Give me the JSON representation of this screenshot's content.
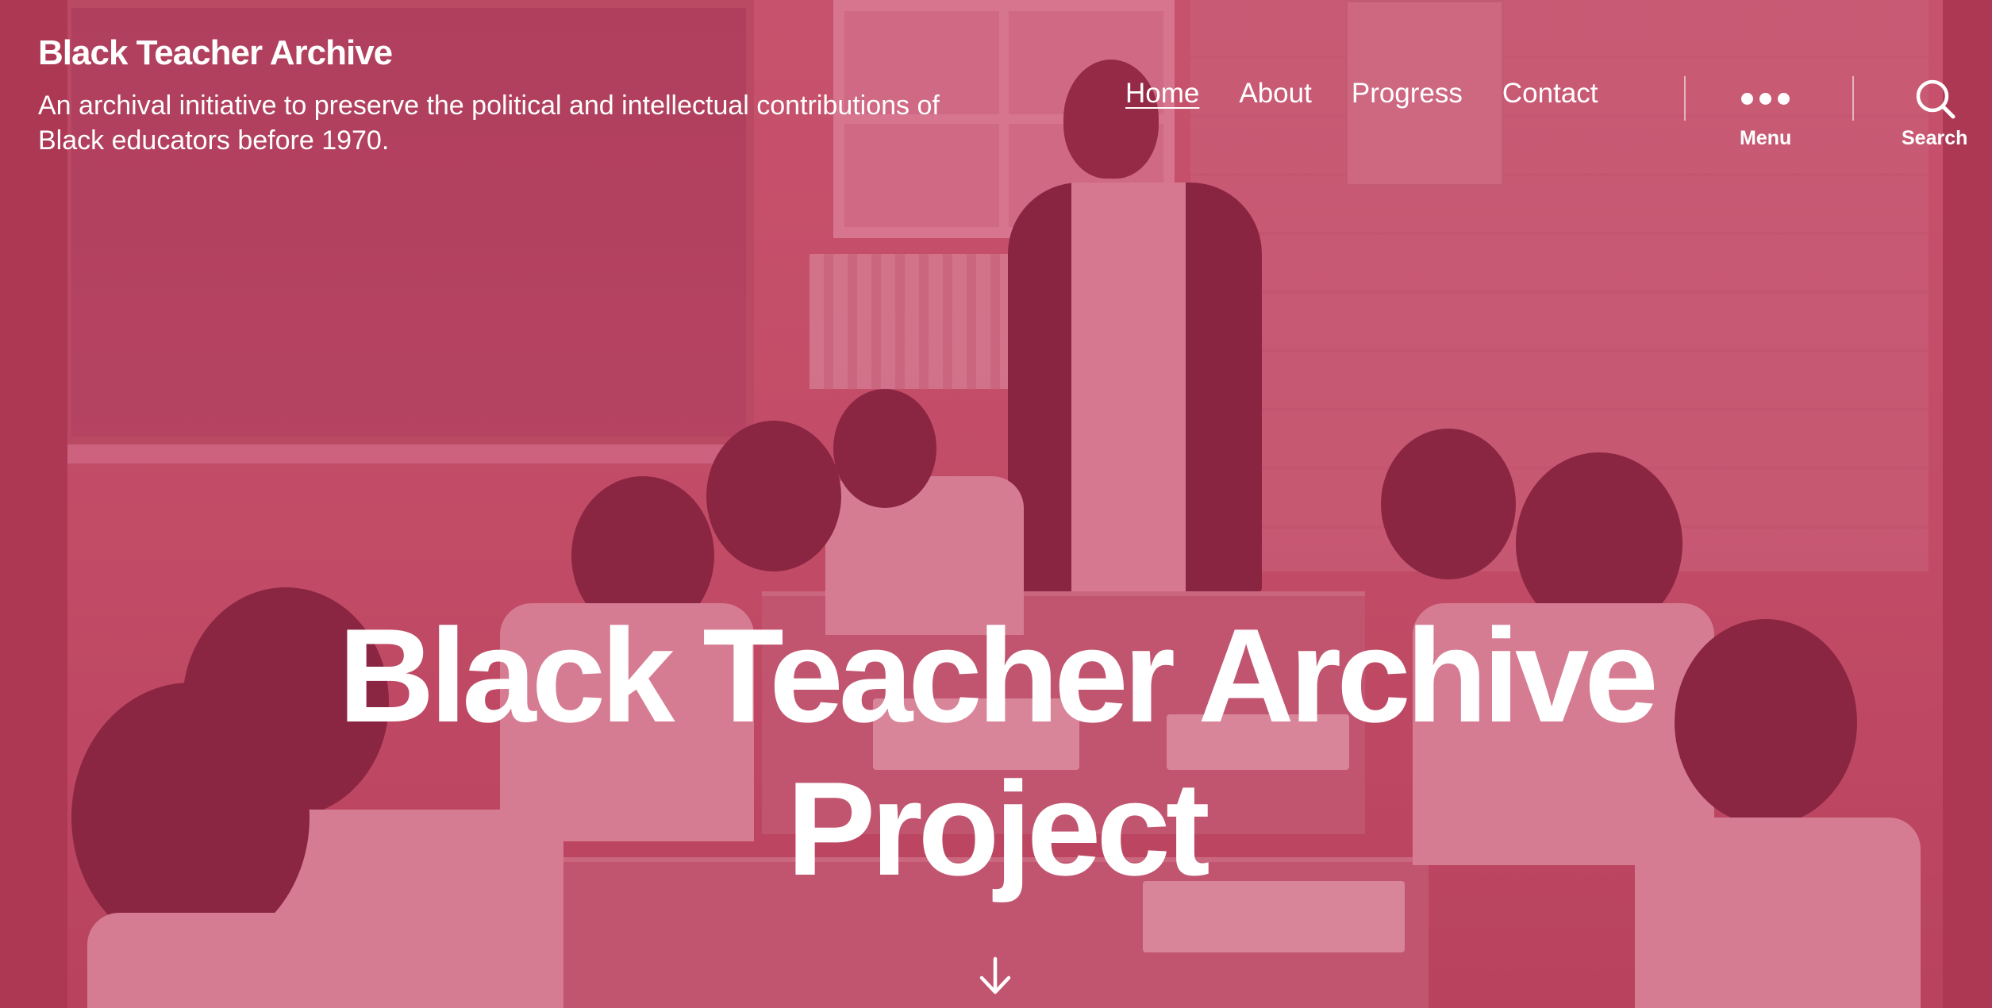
{
  "site": {
    "title": "Black Teacher Archive",
    "description": "An archival initiative to preserve the political and intellectual contributions of Black educators before 1970."
  },
  "nav": {
    "items": [
      {
        "label": "Home",
        "current": true
      },
      {
        "label": "About",
        "current": false
      },
      {
        "label": "Progress",
        "current": false
      },
      {
        "label": "Contact",
        "current": false
      }
    ]
  },
  "toggles": {
    "menu_label": "Menu",
    "search_label": "Search",
    "menu_icon": "ellipsis-icon",
    "search_icon": "search-icon"
  },
  "hero": {
    "title": "Black Teacher Archive Project",
    "scroll_icon": "arrow-down-icon"
  },
  "colors": {
    "overlay": "#c2375a",
    "text": "#ffffff"
  }
}
